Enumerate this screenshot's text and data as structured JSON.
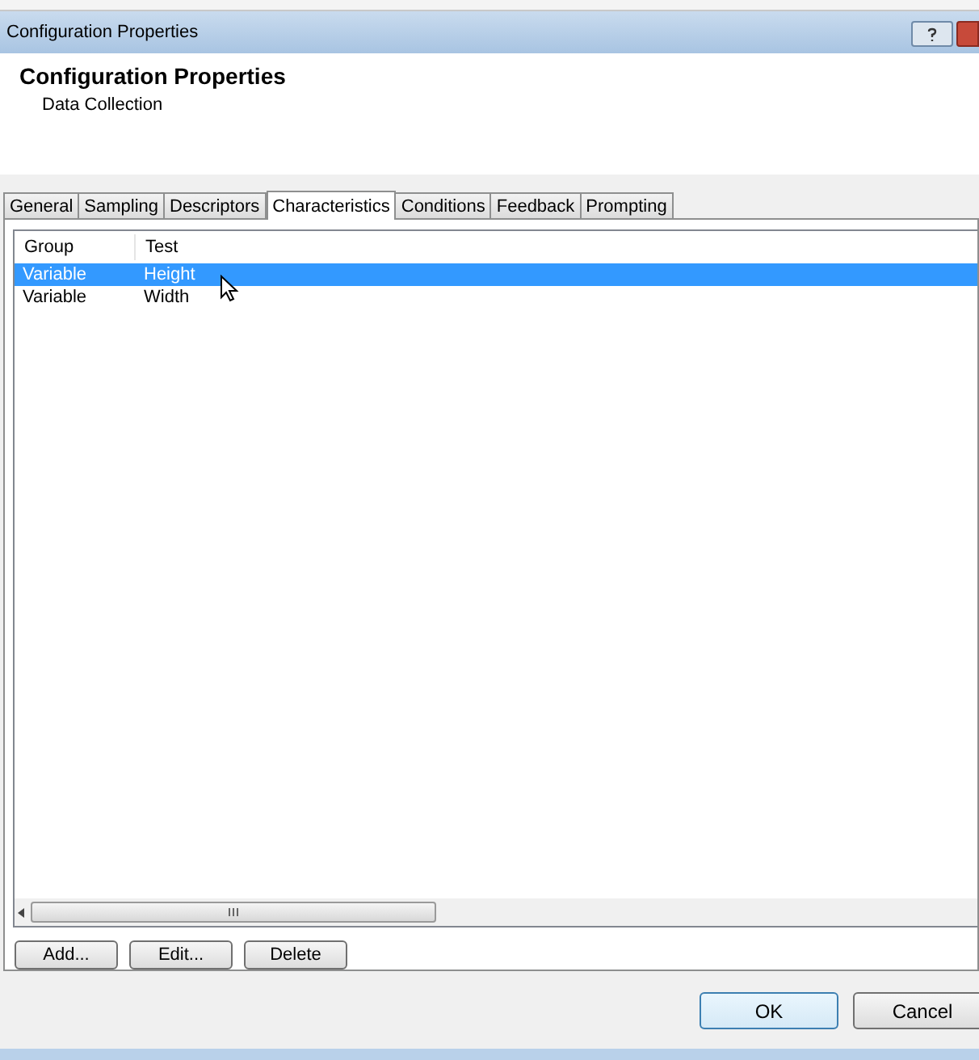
{
  "window": {
    "title": "Configuration Properties"
  },
  "header": {
    "title": "Configuration Properties",
    "subtitle": "Data Collection"
  },
  "tabs": [
    {
      "label": "General",
      "selected": false
    },
    {
      "label": "Sampling",
      "selected": false
    },
    {
      "label": "Descriptors",
      "selected": false
    },
    {
      "label": "Characteristics",
      "selected": true
    },
    {
      "label": "Conditions",
      "selected": false
    },
    {
      "label": "Feedback",
      "selected": false
    },
    {
      "label": "Prompting",
      "selected": false
    }
  ],
  "table": {
    "columns": [
      "Group",
      "Test"
    ],
    "rows": [
      {
        "cells": [
          "Variable",
          "Height"
        ],
        "selected": true
      },
      {
        "cells": [
          "Variable",
          "Width"
        ],
        "selected": false
      }
    ]
  },
  "list_buttons": [
    "Add...",
    "Edit...",
    "Delete"
  ],
  "dialog_buttons": [
    "OK",
    "Cancel"
  ]
}
